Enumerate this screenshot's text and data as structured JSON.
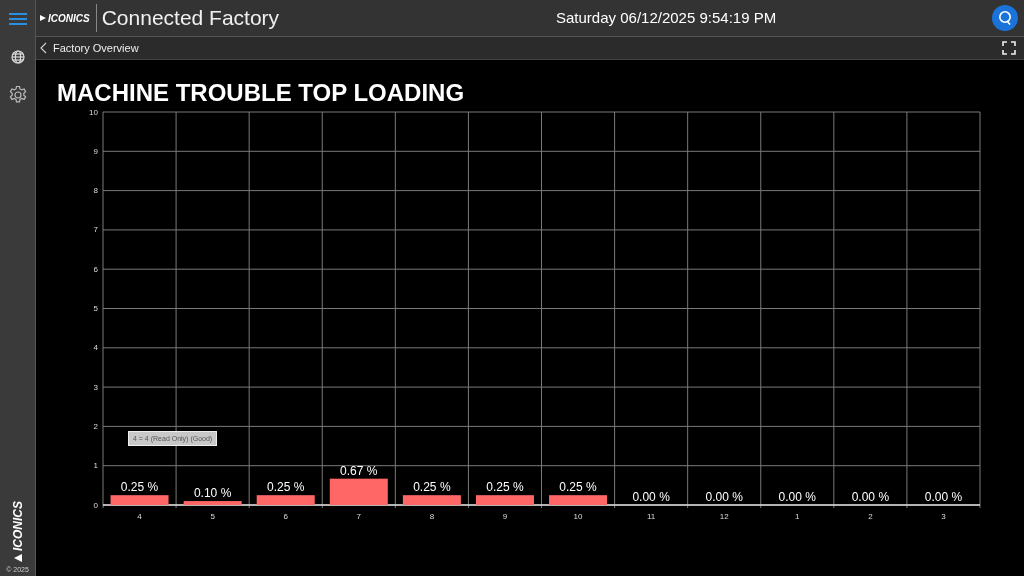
{
  "header": {
    "logo": "ICONICS",
    "title": "Connected Factory",
    "datetime": "Saturday 06/12/2025 9:54:19 PM"
  },
  "sidebar": {
    "logo": "ICONICS",
    "copyright": "© 2025"
  },
  "breadcrumb": {
    "label": "Factory Overview"
  },
  "chart_panel": {
    "title": "MACHINE TROUBLE TOP LOADING",
    "tooltip": "4 = 4 (Read Only) (Good)",
    "chart_data": {
      "type": "bar",
      "categories": [
        "4",
        "5",
        "6",
        "7",
        "8",
        "9",
        "10",
        "11",
        "12",
        "1",
        "2",
        "3"
      ],
      "grid": true,
      "series": [
        {
          "color": "#ff6666",
          "values": [
            0.25,
            0.1,
            0.25,
            0.67,
            0.25,
            0.25,
            0.25,
            0,
            0,
            0,
            0,
            0
          ]
        }
      ],
      "value_labels": [
        "0.25 %",
        "0.10 %",
        "0.25 %",
        "0.67 %",
        "0.25 %",
        "0.25 %",
        "0.25 %",
        "0.00 %",
        "0.00 %",
        "0.00 %",
        "0.00 %",
        "0.00 %"
      ],
      "ylim": [
        0,
        10
      ],
      "yticks": [
        0,
        1,
        2,
        3,
        4,
        5,
        6,
        7,
        8,
        9,
        10
      ]
    }
  }
}
